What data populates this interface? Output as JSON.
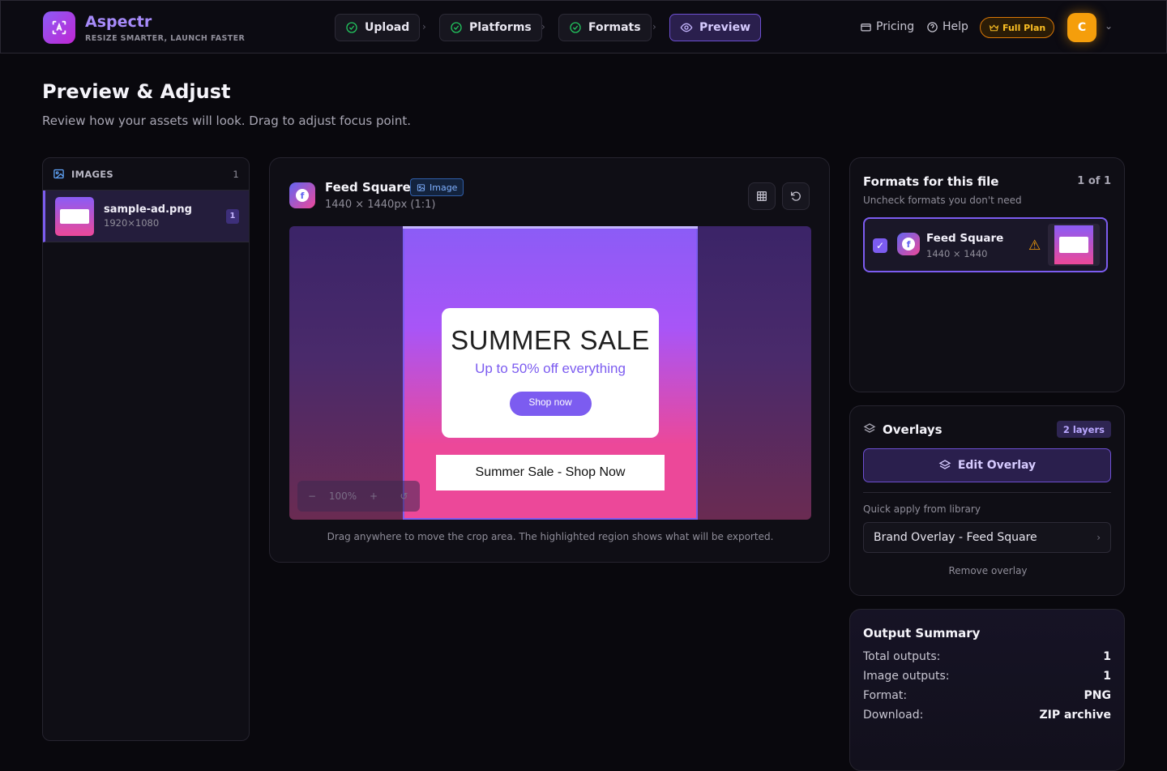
{
  "app": {
    "name": "Aspectr",
    "tagline": "RESIZE SMARTER, LAUNCH FASTER"
  },
  "steps": [
    {
      "label": "Upload",
      "state": "done"
    },
    {
      "label": "Platforms",
      "state": "done"
    },
    {
      "label": "Formats",
      "state": "done"
    },
    {
      "label": "Preview",
      "state": "active"
    }
  ],
  "nav": {
    "pricing": "Pricing",
    "help": "Help",
    "plan": "Full Plan",
    "avatar_initial": "C"
  },
  "page": {
    "title": "Preview & Adjust",
    "subtitle": "Review how your assets will look. Drag to adjust focus point."
  },
  "images_panel": {
    "header": "IMAGES",
    "count": "1",
    "files": [
      {
        "name": "sample-ad.png",
        "dimensions": "1920×1080",
        "format_count": "1"
      }
    ]
  },
  "preview": {
    "format_name": "Feed Square",
    "type_tag": "Image",
    "size": "1440 × 1440px (1:1)",
    "ad": {
      "headline": "SUMMER SALE",
      "subhead": "Up to 50% off everything",
      "cta": "Shop now",
      "banner": "Summer Sale - Shop Now"
    },
    "zoom": "100%",
    "hint": "Drag anywhere to move the crop area. The highlighted region shows what will be exported."
  },
  "formats_panel": {
    "title": "Formats for this file",
    "count": "1 of 1",
    "subtitle": "Uncheck formats you don't need",
    "formats": [
      {
        "name": "Feed Square",
        "dimensions": "1440 × 1440",
        "checked": true,
        "warning": true
      }
    ]
  },
  "overlays": {
    "title": "Overlays",
    "badge": "2 layers",
    "edit_label": "Edit Overlay",
    "quick_label": "Quick apply from library",
    "library_item": "Brand Overlay - Feed Square",
    "remove_label": "Remove overlay"
  },
  "summary": {
    "title": "Output Summary",
    "rows": [
      {
        "key": "Total outputs:",
        "value": "1"
      },
      {
        "key": "Image outputs:",
        "value": "1"
      },
      {
        "key": "Format:",
        "value": "PNG"
      },
      {
        "key": "Download:",
        "value": "ZIP archive"
      }
    ]
  },
  "colors": {
    "accent": "#7c5cf0",
    "warning": "#f59e0b",
    "background": "#09080d"
  }
}
